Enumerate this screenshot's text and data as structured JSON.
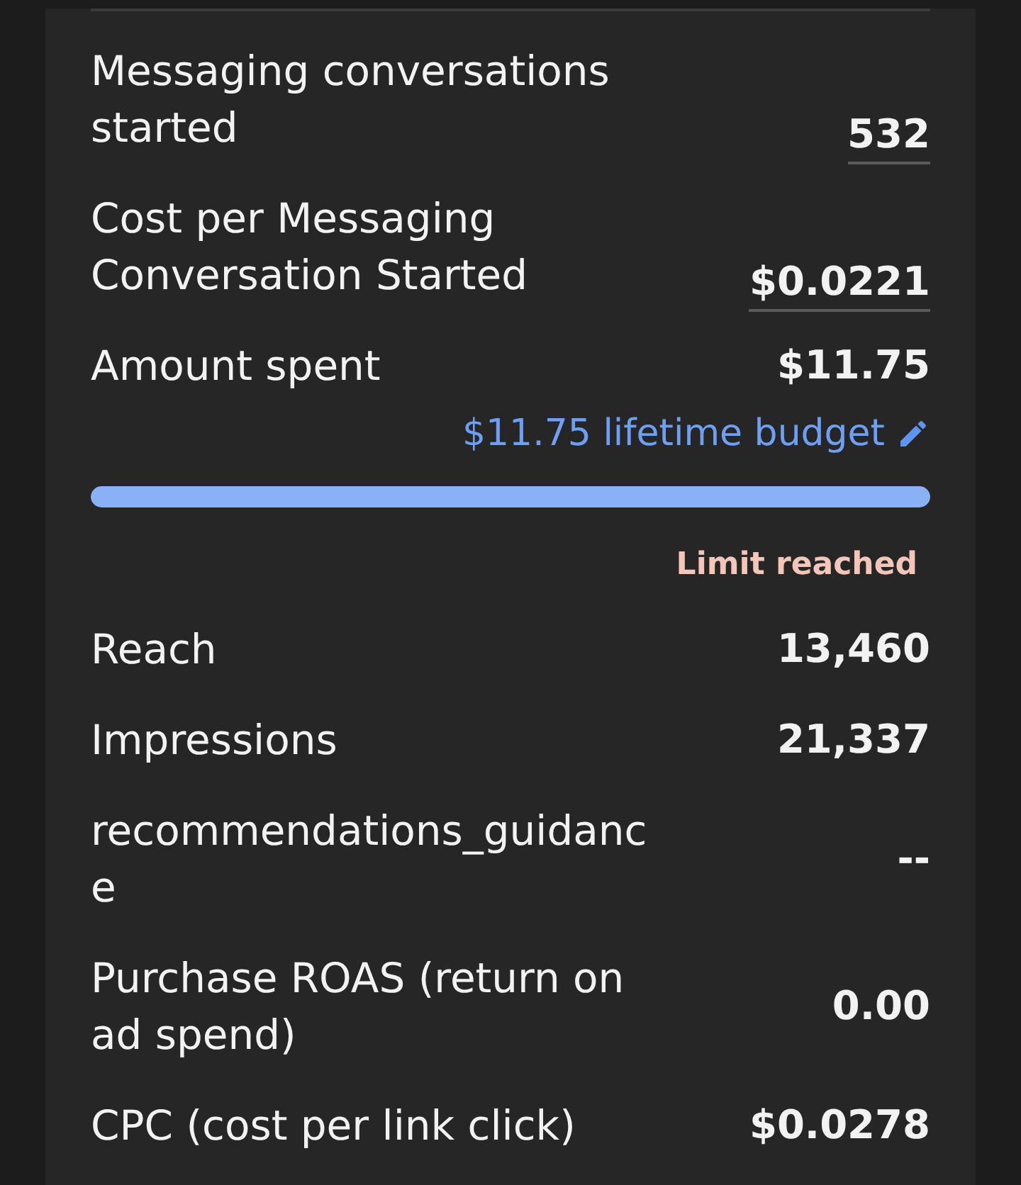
{
  "rows": [
    {
      "kind": "metric",
      "label": "Messaging conversations started",
      "value": "532",
      "underlined": true
    },
    {
      "kind": "metric",
      "label": "Cost per Messaging Conversation Started",
      "value": "$0.0221",
      "underlined": true
    },
    {
      "kind": "spend",
      "label": "Amount spent",
      "value": "$11.75",
      "budget": "$11.75 lifetime budget",
      "level": 1.0,
      "status": "Limit reached"
    },
    {
      "kind": "metric",
      "label": "Reach",
      "value": "13,460",
      "underlined": false
    },
    {
      "kind": "metric",
      "label": "Impressions",
      "value": "21,337",
      "underlined": false
    },
    {
      "kind": "metric",
      "label": "recommendations_guidance",
      "value": "--",
      "underlined": false
    },
    {
      "kind": "metric",
      "label": "Purchase ROAS (return on ad spend)",
      "value": "0.00",
      "underlined": false
    },
    {
      "kind": "metric",
      "label": "CPC (cost per link click)",
      "value": "$0.0278",
      "underlined": false
    }
  ]
}
